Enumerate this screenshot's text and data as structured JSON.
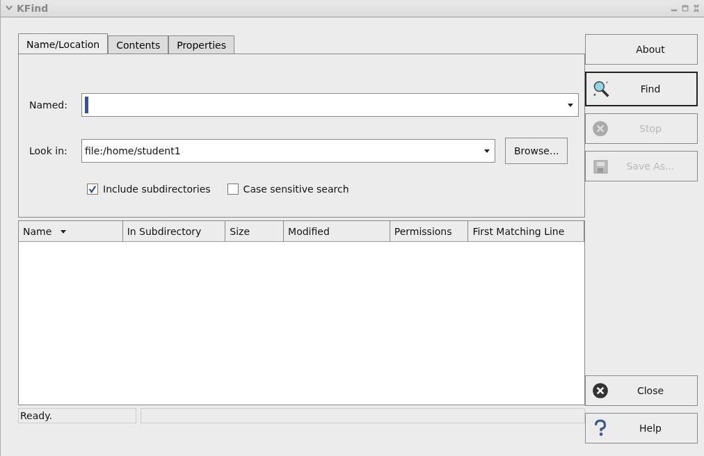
{
  "window": {
    "title": "KFind"
  },
  "tabs": [
    {
      "label": "Name/Location",
      "selected": true
    },
    {
      "label": "Contents",
      "selected": false
    },
    {
      "label": "Properties",
      "selected": false
    }
  ],
  "named": {
    "label": "Named:"
  },
  "look_in": {
    "label": "Look in:",
    "value": "file:/home/student1",
    "browse_button": "Browse..."
  },
  "options": [
    {
      "label": "Include subdirectories",
      "checked": true
    },
    {
      "label": "Case sensitive search",
      "checked": false
    }
  ],
  "table": {
    "columns": [
      {
        "label": "Name",
        "sorted": true
      },
      {
        "label": "In Subdirectory",
        "sorted": false
      },
      {
        "label": "Size",
        "sorted": false
      },
      {
        "label": "Modified",
        "sorted": false
      },
      {
        "label": "Permissions",
        "sorted": false
      },
      {
        "label": "First Matching Line",
        "sorted": false
      }
    ]
  },
  "status_bar": {
    "text": "Ready."
  },
  "buttons_top": [
    {
      "label": "About",
      "kind": "plain",
      "disabled": false,
      "default": false
    },
    {
      "label": "Find",
      "kind": "find",
      "disabled": false,
      "default": true
    },
    {
      "label": "Stop",
      "kind": "stop",
      "disabled": true,
      "default": false
    },
    {
      "label": "Save As...",
      "kind": "save",
      "disabled": true,
      "default": false
    }
  ],
  "buttons_bottom": [
    {
      "label": "Close",
      "kind": "close",
      "disabled": false,
      "default": false
    },
    {
      "label": "Help",
      "kind": "help",
      "disabled": false,
      "default": false
    }
  ]
}
